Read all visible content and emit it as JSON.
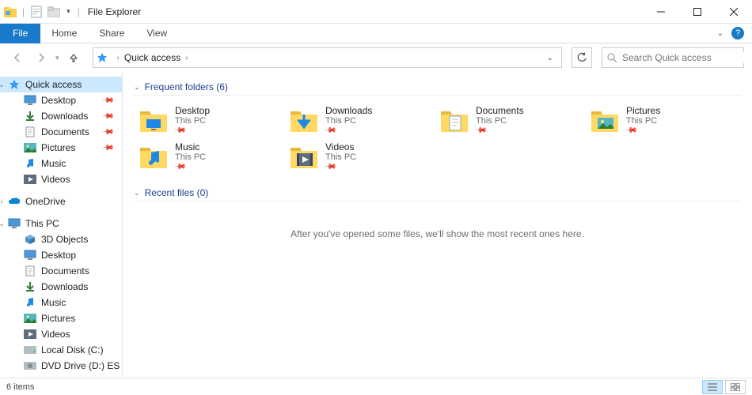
{
  "window": {
    "title": "File Explorer"
  },
  "ribbon": {
    "file": "File",
    "home": "Home",
    "share": "Share",
    "view": "View"
  },
  "nav": {
    "breadcrumb": "Quick access",
    "search_placeholder": "Search Quick access"
  },
  "sidebar": {
    "quick_access": "Quick access",
    "qa_items": [
      {
        "label": "Desktop",
        "pinned": true
      },
      {
        "label": "Downloads",
        "pinned": true
      },
      {
        "label": "Documents",
        "pinned": true
      },
      {
        "label": "Pictures",
        "pinned": true
      },
      {
        "label": "Music",
        "pinned": false
      },
      {
        "label": "Videos",
        "pinned": false
      }
    ],
    "onedrive": "OneDrive",
    "this_pc": "This PC",
    "pc_items": [
      {
        "label": "3D Objects"
      },
      {
        "label": "Desktop"
      },
      {
        "label": "Documents"
      },
      {
        "label": "Downloads"
      },
      {
        "label": "Music"
      },
      {
        "label": "Pictures"
      },
      {
        "label": "Videos"
      },
      {
        "label": "Local Disk (C:)"
      },
      {
        "label": "DVD Drive (D:) ES"
      }
    ]
  },
  "content": {
    "frequent_header": "Frequent folders (6)",
    "recent_header": "Recent files (0)",
    "recent_empty": "After you've opened some files, we'll show the most recent ones here.",
    "folders": [
      {
        "name": "Desktop",
        "loc": "This PC",
        "icon": "desktop"
      },
      {
        "name": "Downloads",
        "loc": "This PC",
        "icon": "downloads"
      },
      {
        "name": "Documents",
        "loc": "This PC",
        "icon": "documents"
      },
      {
        "name": "Pictures",
        "loc": "This PC",
        "icon": "pictures"
      },
      {
        "name": "Music",
        "loc": "This PC",
        "icon": "music"
      },
      {
        "name": "Videos",
        "loc": "This PC",
        "icon": "videos"
      }
    ]
  },
  "status": {
    "text": "6 items"
  }
}
